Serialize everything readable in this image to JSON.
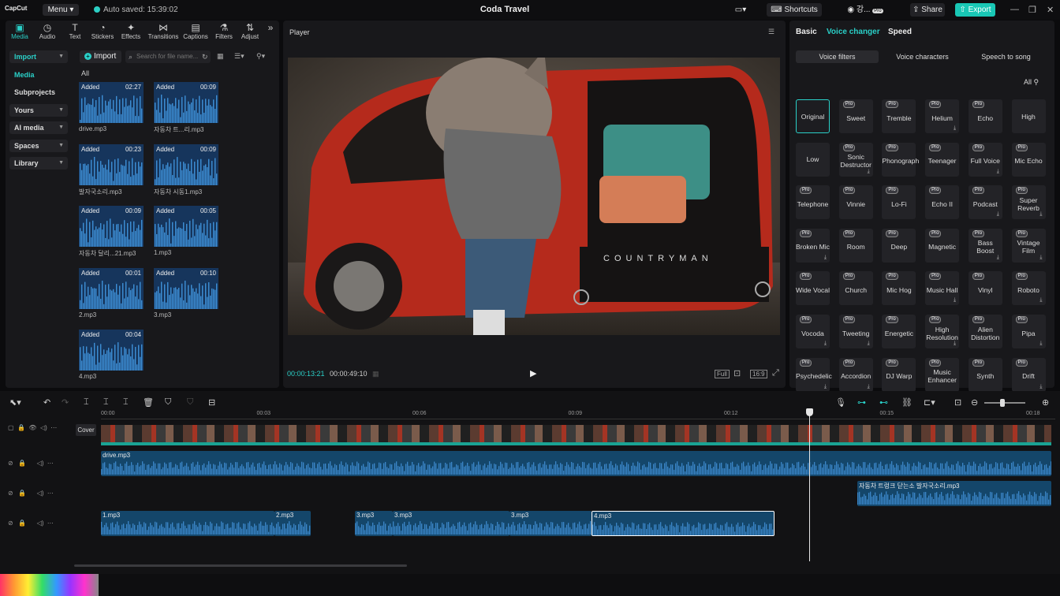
{
  "titlebar": {
    "logo": "CapCut",
    "menu_label": "Menu",
    "autosave": "Auto saved: 15:39:02",
    "title": "Coda Travel",
    "shortcuts": "Shortcuts",
    "account": "강...",
    "share": "Share",
    "export": "Export"
  },
  "toolbar": [
    {
      "label": "Media",
      "icon": "media-icon"
    },
    {
      "label": "Audio",
      "icon": "audio-icon"
    },
    {
      "label": "Text",
      "icon": "text-icon"
    },
    {
      "label": "Stickers",
      "icon": "stickers-icon"
    },
    {
      "label": "Effects",
      "icon": "effects-icon"
    },
    {
      "label": "Transitions",
      "icon": "transitions-icon"
    },
    {
      "label": "Captions",
      "icon": "captions-icon"
    },
    {
      "label": "Filters",
      "icon": "filters-icon"
    },
    {
      "label": "Adjust",
      "icon": "adjust-icon"
    }
  ],
  "sidenav": {
    "import": "Import",
    "media": "Media",
    "subprojects": "Subprojects",
    "yours": "Yours",
    "ai_media": "AI media",
    "spaces": "Spaces",
    "library": "Library"
  },
  "media": {
    "import_btn": "Import",
    "search_placeholder": "Search for file name...",
    "all_label": "All",
    "added": "Added",
    "files": [
      {
        "name": "drive.mp3",
        "duration": "02:27"
      },
      {
        "name": "자동차 트...리.mp3",
        "duration": "00:09"
      },
      {
        "name": "발자국소리.mp3",
        "duration": "00:23"
      },
      {
        "name": "자동차 시동1.mp3",
        "duration": "00:09"
      },
      {
        "name": "자동차 달리...21.mp3",
        "duration": "00:09"
      },
      {
        "name": "1.mp3",
        "duration": "00:05"
      },
      {
        "name": "2.mp3",
        "duration": "00:01"
      },
      {
        "name": "3.mp3",
        "duration": "00:10"
      },
      {
        "name": "4.mp3",
        "duration": "00:04"
      }
    ]
  },
  "player": {
    "title": "Player",
    "current_time": "00:00:13:21",
    "total_time": "00:00:49:10",
    "car_text": "COUNTRYMAN",
    "aspect": "16:9",
    "full": "Full"
  },
  "right": {
    "tabs": [
      "Basic",
      "Voice changer",
      "Speed"
    ],
    "subtabs": [
      "Voice filters",
      "Voice characters",
      "Speech to song"
    ],
    "all_filter": "All",
    "pro_label": "Pro",
    "voices": [
      {
        "name": "Original",
        "pro": false,
        "dl": false
      },
      {
        "name": "Sweet",
        "pro": true,
        "dl": false
      },
      {
        "name": "Tremble",
        "pro": true,
        "dl": false
      },
      {
        "name": "Helium",
        "pro": true,
        "dl": true
      },
      {
        "name": "Echo",
        "pro": true,
        "dl": false
      },
      {
        "name": "High",
        "pro": false,
        "dl": false
      },
      {
        "name": "Low",
        "pro": false,
        "dl": false
      },
      {
        "name": "Sonic Destructor",
        "pro": true,
        "dl": true
      },
      {
        "name": "Phonograph",
        "pro": true,
        "dl": false
      },
      {
        "name": "Teenager",
        "pro": true,
        "dl": false
      },
      {
        "name": "Full Voice",
        "pro": true,
        "dl": true
      },
      {
        "name": "Mic Echo",
        "pro": true,
        "dl": false
      },
      {
        "name": "Telephone",
        "pro": true,
        "dl": false
      },
      {
        "name": "Vinnie",
        "pro": true,
        "dl": false
      },
      {
        "name": "Lo-Fi",
        "pro": true,
        "dl": false
      },
      {
        "name": "Echo II",
        "pro": true,
        "dl": false
      },
      {
        "name": "Podcast",
        "pro": true,
        "dl": true
      },
      {
        "name": "Super Reverb",
        "pro": true,
        "dl": true
      },
      {
        "name": "Broken Mic",
        "pro": true,
        "dl": true
      },
      {
        "name": "Room",
        "pro": true,
        "dl": false
      },
      {
        "name": "Deep",
        "pro": true,
        "dl": false
      },
      {
        "name": "Magnetic",
        "pro": true,
        "dl": false
      },
      {
        "name": "Bass Boost",
        "pro": true,
        "dl": true
      },
      {
        "name": "Vintage Film",
        "pro": true,
        "dl": true
      },
      {
        "name": "Wide Vocal",
        "pro": true,
        "dl": false
      },
      {
        "name": "Church",
        "pro": true,
        "dl": false
      },
      {
        "name": "Mic Hog",
        "pro": true,
        "dl": false
      },
      {
        "name": "Music Hall",
        "pro": true,
        "dl": true
      },
      {
        "name": "Vinyl",
        "pro": true,
        "dl": false
      },
      {
        "name": "Roboto",
        "pro": true,
        "dl": true
      },
      {
        "name": "Vocoda",
        "pro": true,
        "dl": true
      },
      {
        "name": "Tweeting",
        "pro": true,
        "dl": true
      },
      {
        "name": "Energetic",
        "pro": true,
        "dl": false
      },
      {
        "name": "High Resolution",
        "pro": true,
        "dl": true
      },
      {
        "name": "Alien Distortion",
        "pro": true,
        "dl": false
      },
      {
        "name": "Pipa",
        "pro": true,
        "dl": true
      },
      {
        "name": "Psychedelic",
        "pro": true,
        "dl": true
      },
      {
        "name": "Accordion",
        "pro": true,
        "dl": true
      },
      {
        "name": "DJ Warp",
        "pro": true,
        "dl": false
      },
      {
        "name": "Music Enhancer",
        "pro": true,
        "dl": false
      },
      {
        "name": "Synth",
        "pro": true,
        "dl": false
      },
      {
        "name": "Drift",
        "pro": true,
        "dl": true
      }
    ]
  },
  "timeline": {
    "ticks": [
      "00:00",
      "00:03",
      "00:06",
      "00:09",
      "00:12",
      "00:15",
      "00:18"
    ],
    "cover": "Cover",
    "clips": {
      "drive": "drive.mp3",
      "car": "자동차 트렁크 닫는소 발자국소리.mp3",
      "c1": "1.mp3",
      "c2": "2.mp3",
      "c3a": "3.mp3",
      "c3b": "3.mp3",
      "c3c": "3.mp3",
      "c4": "4.mp3"
    }
  },
  "colors": {
    "accent": "#2ad0c8",
    "clip": "#14466a",
    "panel": "#18181b"
  }
}
